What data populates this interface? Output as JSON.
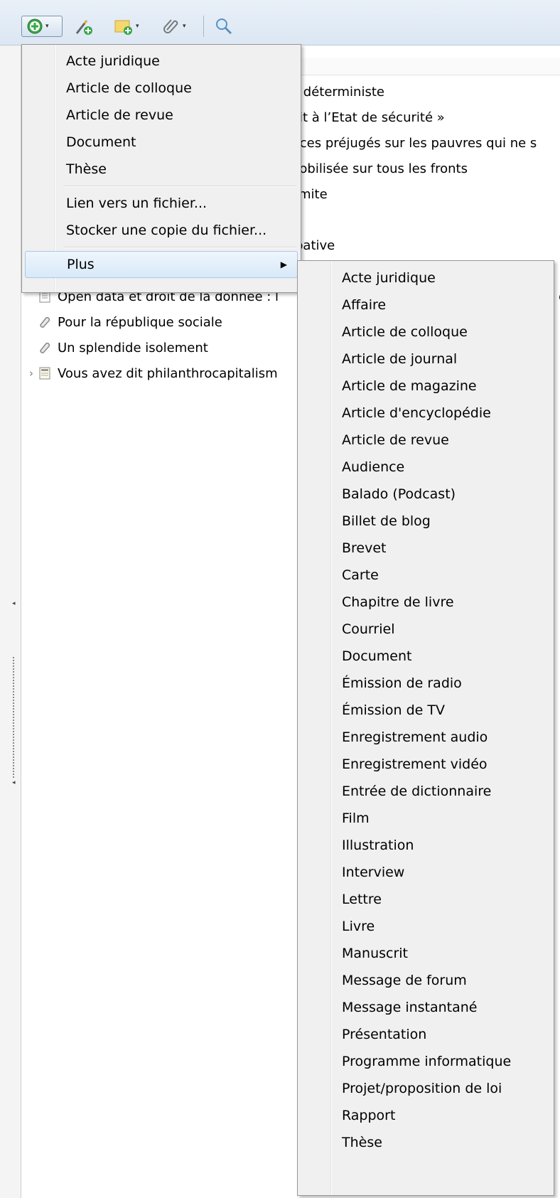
{
  "toolbar": {
    "new_item_icon": "plus-circle-icon",
    "new_note_icon": "wand-plus-icon",
    "add_attachment_icon": "note-plus-icon",
    "link_icon": "paperclip-icon",
    "search_icon": "magnifier-icon"
  },
  "background_titles": [
    "e déterministe",
    "oit à l’Etat de sécurité »",
    ": ces préjugés sur les pauvres qui ne s",
    "nobilisée sur tous les fronts",
    "limite",
    "",
    "ipative"
  ],
  "list_items": [
    {
      "title": "Open data et droit de la donnée : l",
      "icon": "document-icon",
      "expand": false,
      "suffix": "er"
    },
    {
      "title": "Pour la république sociale",
      "icon": "link-attachment-icon",
      "expand": false
    },
    {
      "title": "Un splendide isolement",
      "icon": "link-attachment-icon",
      "expand": false
    },
    {
      "title": "Vous avez dit philanthrocapitalism",
      "icon": "newspaper-icon",
      "expand": true
    }
  ],
  "main_menu": {
    "items": [
      "Acte juridique",
      "Article de colloque",
      "Article de revue",
      "Document",
      "Thèse"
    ],
    "file_items": [
      "Lien vers un fichier...",
      "Stocker une copie du fichier..."
    ],
    "more_label": "Plus"
  },
  "sub_menu": {
    "items": [
      "Acte juridique",
      "Affaire",
      "Article de colloque",
      "Article de journal",
      "Article de magazine",
      "Article d'encyclopédie",
      "Article de revue",
      "Audience",
      "Balado (Podcast)",
      "Billet de blog",
      "Brevet",
      "Carte",
      "Chapitre de livre",
      "Courriel",
      "Document",
      "Émission de radio",
      "Émission de TV",
      "Enregistrement audio",
      "Enregistrement vidéo",
      "Entrée de dictionnaire",
      "Film",
      "Illustration",
      "Interview",
      "Lettre",
      "Livre",
      "Manuscrit",
      "Message de forum",
      "Message instantané",
      "Présentation",
      "Programme informatique",
      "Projet/proposition de loi",
      "Rapport",
      "Thèse"
    ]
  },
  "colors": {
    "menu_bg": "#f0f0f0",
    "highlight_border": "#a8c8e8",
    "toolbar_bg": "#e3ecf6"
  }
}
